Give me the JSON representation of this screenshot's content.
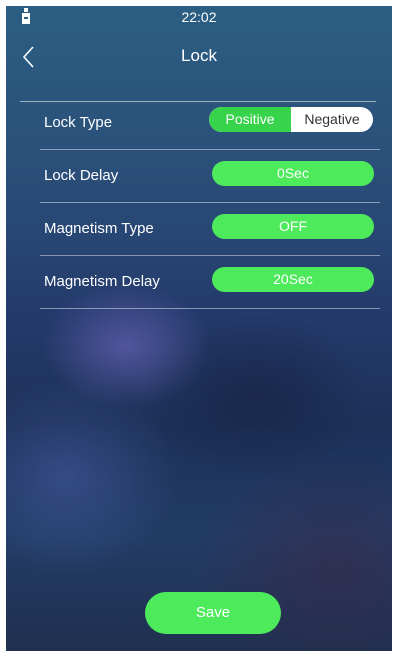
{
  "status_bar": {
    "time": "22:02",
    "icon": "device-icon"
  },
  "header": {
    "title": "Lock",
    "back_icon": "chevron-left-icon"
  },
  "settings": [
    {
      "label": "Lock Type",
      "type": "toggle",
      "options": [
        "Positive",
        "Negative"
      ],
      "selected": "Positive"
    },
    {
      "label": "Lock Delay",
      "type": "value",
      "value": "0Sec"
    },
    {
      "label": "Magnetism Type",
      "type": "value",
      "value": "OFF"
    },
    {
      "label": "Magnetism Delay",
      "type": "value",
      "value": "20Sec"
    }
  ],
  "footer": {
    "save_label": "Save"
  },
  "colors": {
    "accent": "#4dea5c",
    "toggle_active": "#37d34a",
    "text": "#ffffff"
  }
}
